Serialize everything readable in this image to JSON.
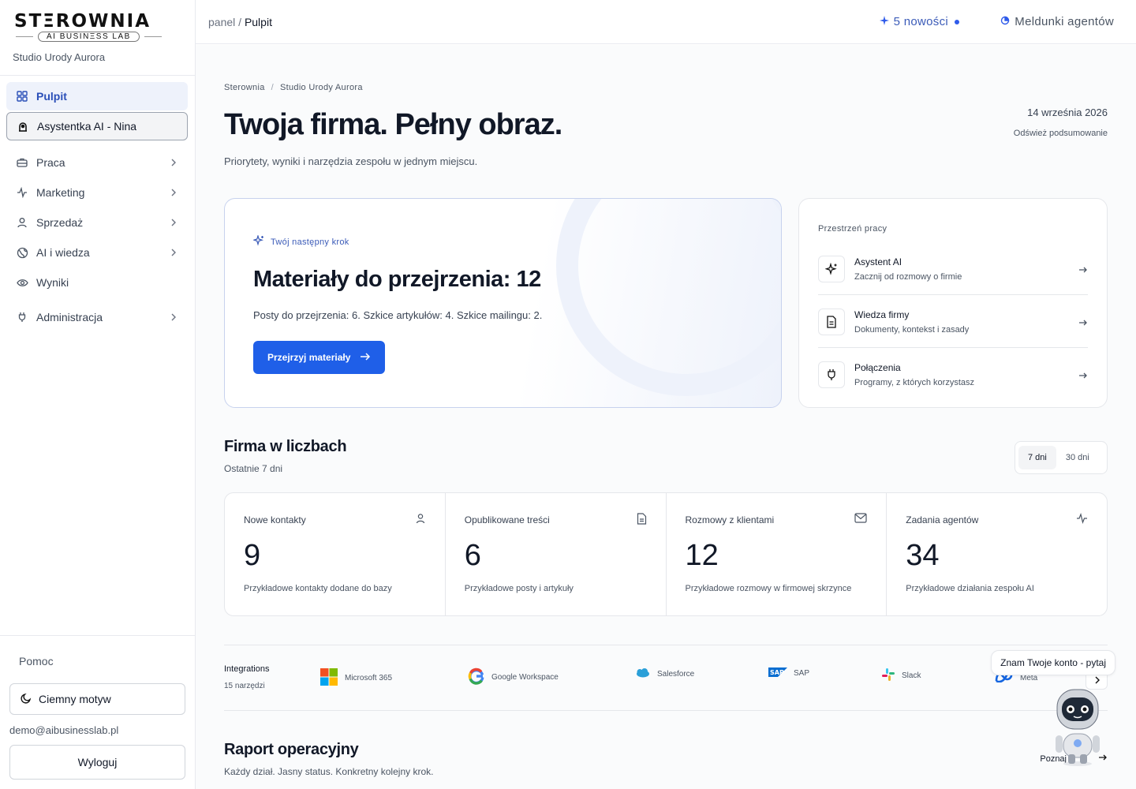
{
  "brand": {
    "logo": "STΞROWNIA",
    "logo_sub": "AI BUSINΞSS LAB",
    "company": "Studio Urody Aurora"
  },
  "sidebar": {
    "items": [
      {
        "label": "Pulpit"
      },
      {
        "label": "Asystentka AI - Nina"
      },
      {
        "label": "Praca"
      },
      {
        "label": "Marketing"
      },
      {
        "label": "Sprzedaż"
      },
      {
        "label": "AI i wiedza"
      },
      {
        "label": "Wyniki"
      },
      {
        "label": "Administracja"
      }
    ],
    "help": "Pomoc",
    "theme": "Ciemny motyw",
    "email": "demo@aibusinesslab.pl",
    "logout": "Wyloguj"
  },
  "topbar": {
    "crumb_root": "panel",
    "crumb_sep": "/",
    "crumb_current": "Pulpit",
    "news": "5 nowości",
    "reports": "Meldunki agentów"
  },
  "page": {
    "crumb1": "Sterownia",
    "crumb_sep": "/",
    "crumb2": "Studio Urody Aurora",
    "title": "Twoja firma. Pełny obraz.",
    "subtitle": "Priorytety, wyniki i narzędzia zespołu w jednym miejscu.",
    "date": "14 września 2026",
    "refresh": "Odśwież podsumowanie"
  },
  "hero": {
    "label": "Twój następny krok",
    "title": "Materiały do przejrzenia: 12",
    "text": "Posty do przejrzenia: 6. Szkice artykułów: 4. Szkice mailingu: 2.",
    "button": "Przejrzyj materiały"
  },
  "workspace": {
    "title": "Przestrzeń pracy",
    "items": [
      {
        "name": "Asystent AI",
        "desc": "Zacznij od rozmowy o firmie"
      },
      {
        "name": "Wiedza firmy",
        "desc": "Dokumenty, kontekst i zasady"
      },
      {
        "name": "Połączenia",
        "desc": "Programy, z których korzystasz"
      }
    ]
  },
  "stats_section": {
    "title": "Firma w liczbach",
    "subtitle": "Ostatnie 7 dni",
    "toggle": [
      "7 dni",
      "30 dni"
    ]
  },
  "stats": [
    {
      "label": "Nowe kontakty",
      "value": "9",
      "desc": "Przykładowe kontakty dodane do bazy"
    },
    {
      "label": "Opublikowane treści",
      "value": "6",
      "desc": "Przykładowe posty i artykuły"
    },
    {
      "label": "Rozmowy z klientami",
      "value": "12",
      "desc": "Przykładowe rozmowy w firmowej skrzynce"
    },
    {
      "label": "Zadania agentów",
      "value": "34",
      "desc": "Przykładowe działania zespołu AI"
    }
  ],
  "integrations": {
    "title": "Integrations",
    "count": "15 narzędzi",
    "items": [
      "Microsoft 365",
      "Google Workspace",
      "Salesforce",
      "SAP",
      "Slack",
      "Meta"
    ]
  },
  "tooltip": "Znam Twoje konto - pytaj",
  "report": {
    "title": "Raport operacyjny",
    "subtitle": "Każdy dział. Jasny status. Konkretny kolejny krok.",
    "link": "Poznaj"
  },
  "colors": {
    "accent": "#1f5fe8",
    "active_nav": "#2a4fb8",
    "border": "#e5e7eb"
  }
}
